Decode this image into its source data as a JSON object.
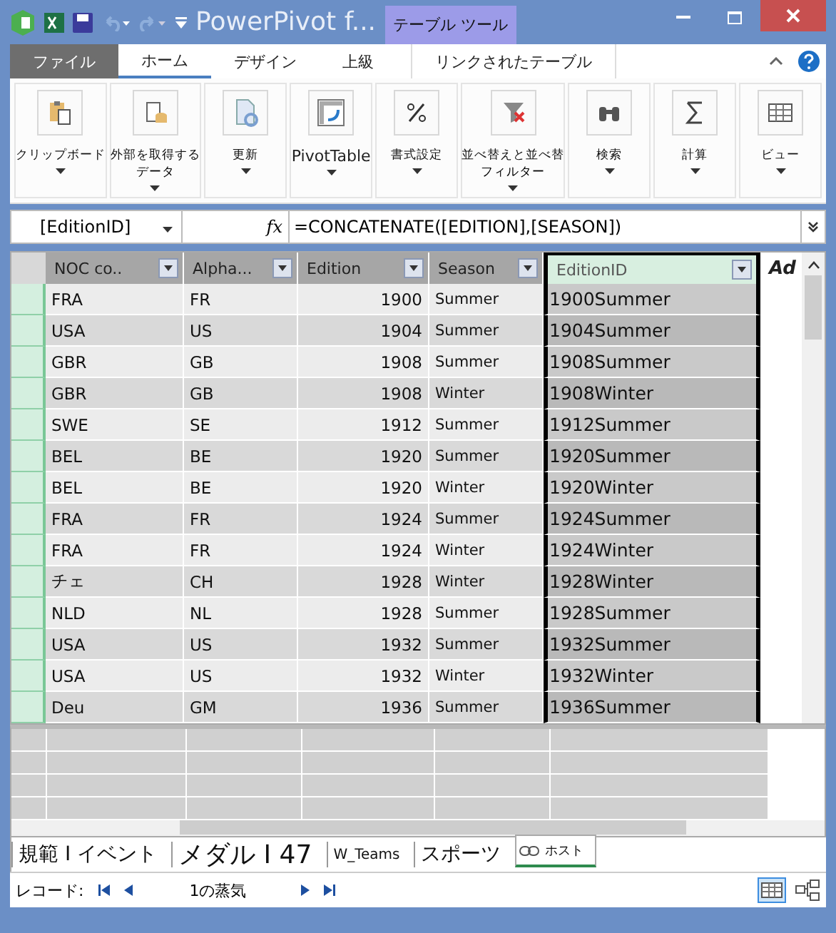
{
  "window": {
    "title": "PowerPivot f...",
    "context_tab_group": "テーブル ツール"
  },
  "ribbon_tabs": [
    {
      "label": "ファイル",
      "kind": "file",
      "selected": false
    },
    {
      "label": "ホーム",
      "kind": "normal",
      "selected": true
    },
    {
      "label": "デザイン",
      "kind": "normal",
      "selected": false
    },
    {
      "label": "上級",
      "kind": "normal",
      "selected": false
    },
    {
      "label": "リンクされたテーブル",
      "kind": "context",
      "selected": false
    }
  ],
  "ribbon_groups": [
    {
      "label": "クリップボード"
    },
    {
      "label": "外部を取得する",
      "label2": "データ"
    },
    {
      "label": "更新"
    },
    {
      "label": "PivotTable"
    },
    {
      "label": "書式設定"
    },
    {
      "label": "並べ替えと並べ替",
      "label2": "フィルター"
    },
    {
      "label": "検索"
    },
    {
      "label": "計算"
    },
    {
      "label": "ビュー"
    }
  ],
  "formula_bar": {
    "name_box": "[EditionID]",
    "fx": "fx",
    "formula": "=CONCATENATE([EDITION],[SEASON])"
  },
  "table": {
    "columns": [
      {
        "label": "NOC co..",
        "selected": false
      },
      {
        "label": "Alpha...",
        "selected": false
      },
      {
        "label": "Edition",
        "selected": false
      },
      {
        "label": "Season",
        "selected": false
      },
      {
        "label": "EditionID",
        "selected": true
      },
      {
        "label": "Ad",
        "selected": false
      }
    ],
    "rows": [
      [
        "FRA",
        "FR",
        "1900",
        "Summer",
        "1900Summer"
      ],
      [
        "USA",
        "US",
        "1904",
        "Summer",
        "1904Summer"
      ],
      [
        "GBR",
        "GB",
        "1908",
        "Summer",
        "1908Summer"
      ],
      [
        "GBR",
        "GB",
        "1908",
        "Winter",
        "1908Winter"
      ],
      [
        "SWE",
        "SE",
        "1912",
        "Summer",
        "1912Summer"
      ],
      [
        "BEL",
        "BE",
        "1920",
        "Summer",
        "1920Summer"
      ],
      [
        "BEL",
        "BE",
        "1920",
        "Winter",
        "1920Winter"
      ],
      [
        "FRA",
        "FR",
        "1924",
        "Summer",
        "1924Summer"
      ],
      [
        "FRA",
        "FR",
        "1924",
        "Winter",
        "1924Winter"
      ],
      [
        "チェ",
        "CH",
        "1928",
        "Winter",
        "1928Winter"
      ],
      [
        "NLD",
        "NL",
        "1928",
        "Summer",
        "1928Summer"
      ],
      [
        "USA",
        "US",
        "1932",
        "Summer",
        "1932Summer"
      ],
      [
        "USA",
        "US",
        "1932",
        "Winter",
        "1932Winter"
      ],
      [
        "Deu",
        "GM",
        "1936",
        "Summer",
        "1936Summer"
      ]
    ]
  },
  "sheet_tabs": [
    {
      "label": "規範 I イベント",
      "kind": "large",
      "selected": false
    },
    {
      "label": "メダル I 47",
      "kind": "huge",
      "selected": false
    },
    {
      "label": "W_Teams",
      "kind": "small",
      "selected": false
    },
    {
      "label": "スポーツ",
      "kind": "large",
      "selected": false
    },
    {
      "label": "ホスト",
      "kind": "linked",
      "selected": true
    }
  ],
  "status_bar": {
    "record_label": "レコード:",
    "record_position": "1の蒸気"
  }
}
